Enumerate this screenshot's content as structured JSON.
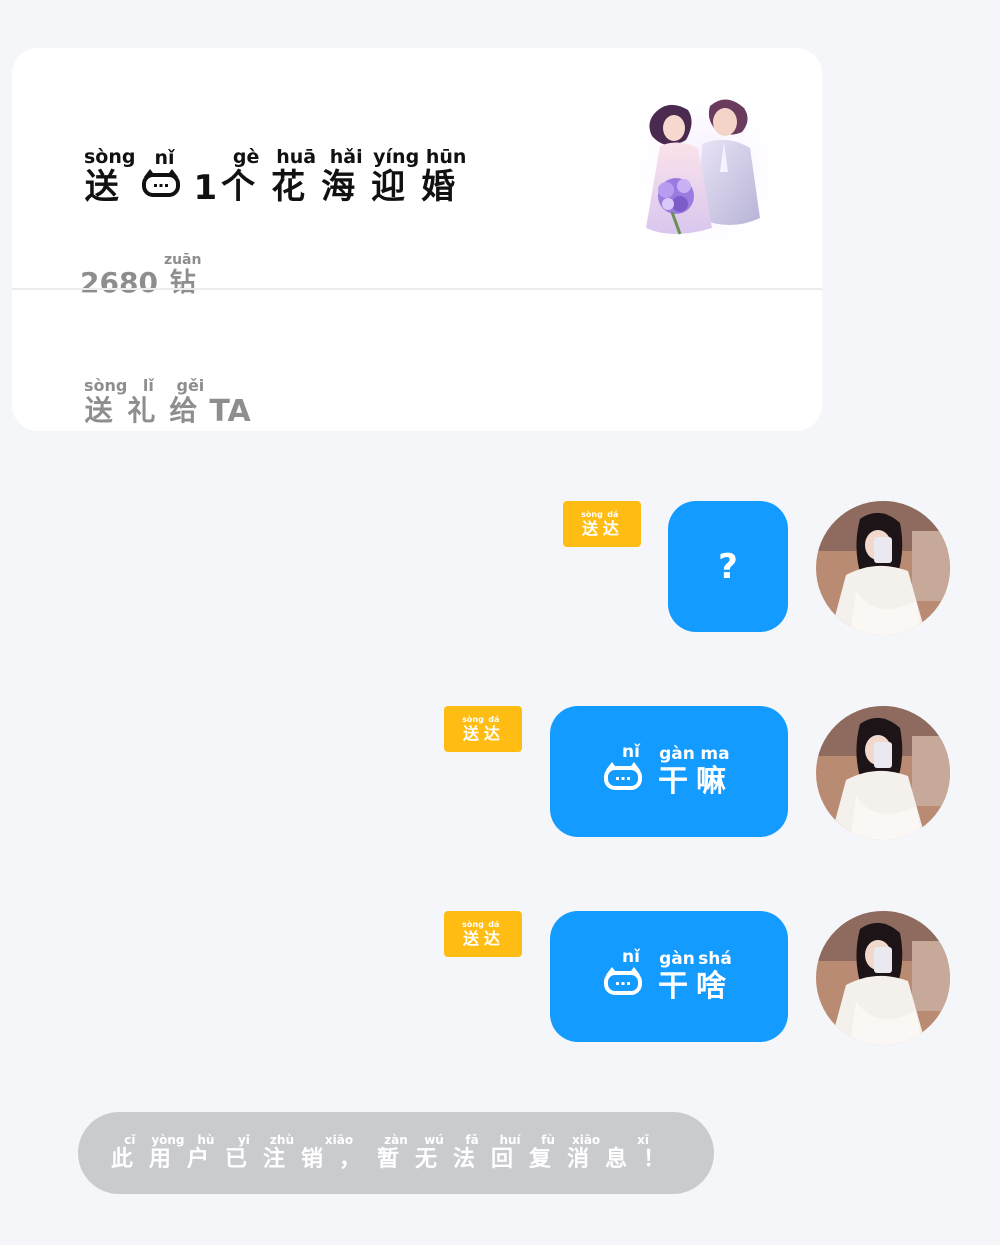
{
  "gift_card": {
    "title": {
      "prefix": {
        "char": "送",
        "pinyin": "sòng"
      },
      "pronoun": {
        "pinyin": "nǐ",
        "icon": "cat-face-icon"
      },
      "count": "1",
      "chars": [
        {
          "char": "个",
          "pinyin": "gè"
        },
        {
          "char": "花",
          "pinyin": "huā"
        },
        {
          "char": "海",
          "pinyin": "hǎi"
        },
        {
          "char": "迎",
          "pinyin": "yíng"
        },
        {
          "char": "婚",
          "pinyin": "hūn"
        }
      ]
    },
    "price": {
      "amount": "2680",
      "unit_char": "钻",
      "unit_pinyin": "zuān"
    },
    "gift_image": "wedding-couple-with-bouquet-image",
    "send_gift": {
      "chars": [
        {
          "char": "送",
          "pinyin": "sòng"
        },
        {
          "char": "礼",
          "pinyin": "lǐ"
        },
        {
          "char": "给",
          "pinyin": "gěi"
        }
      ],
      "target": "TA"
    }
  },
  "messages": [
    {
      "type": "symbol",
      "text": "?",
      "status": [
        {
          "char": "送",
          "pinyin": "sòng"
        },
        {
          "char": "达",
          "pinyin": "dá"
        }
      ],
      "avatar": "user-avatar-girl-photo"
    },
    {
      "type": "ruby",
      "chars": [
        {
          "char": "",
          "pinyin": "nǐ",
          "icon": "cat-face-icon"
        },
        {
          "char": "干",
          "pinyin": "gàn"
        },
        {
          "char": "嘛",
          "pinyin": "ma"
        }
      ],
      "status": [
        {
          "char": "送",
          "pinyin": "sòng"
        },
        {
          "char": "达",
          "pinyin": "dá"
        }
      ],
      "avatar": "user-avatar-girl-photo"
    },
    {
      "type": "ruby",
      "chars": [
        {
          "char": "",
          "pinyin": "nǐ",
          "icon": "cat-face-icon"
        },
        {
          "char": "干",
          "pinyin": "gàn"
        },
        {
          "char": "啥",
          "pinyin": "shá"
        }
      ],
      "status": [
        {
          "char": "送",
          "pinyin": "sòng"
        },
        {
          "char": "达",
          "pinyin": "dá"
        }
      ],
      "avatar": "user-avatar-girl-photo"
    }
  ],
  "notice": {
    "chars": [
      {
        "char": "此",
        "pinyin": "cǐ"
      },
      {
        "char": "用",
        "pinyin": "yòng"
      },
      {
        "char": "户",
        "pinyin": "hù"
      },
      {
        "char": "已",
        "pinyin": "yǐ"
      },
      {
        "char": "注",
        "pinyin": "zhù"
      },
      {
        "char": "销，",
        "pinyin": "xiāo"
      },
      {
        "char": "暂",
        "pinyin": "zàn"
      },
      {
        "char": "无",
        "pinyin": "wú"
      },
      {
        "char": "法",
        "pinyin": "fǎ"
      },
      {
        "char": "回",
        "pinyin": "huí"
      },
      {
        "char": "复",
        "pinyin": "fù"
      },
      {
        "char": "消",
        "pinyin": "xiāo"
      },
      {
        "char": "息！",
        "pinyin": "xī"
      }
    ]
  },
  "colors": {
    "background": "#f4f6f9",
    "bubble": "#149bff",
    "status_tag": "#ffbd14",
    "notice_bg": "#c9cbcf",
    "muted_text": "#8e8e8e"
  }
}
